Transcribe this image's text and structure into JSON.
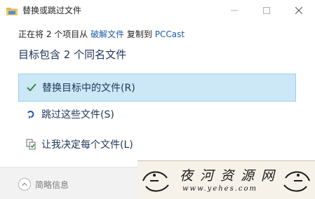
{
  "window": {
    "title": "替换或跳过文件",
    "minimize": "—",
    "maximize": "☐",
    "close": "✕"
  },
  "source_line": {
    "prefix": "正在将 2 个项目从 ",
    "source": "破解文件",
    "middle": " 复制到 ",
    "destination": "PCCast"
  },
  "headline": "目标包含 2 个同名文件",
  "options": {
    "replace": "替换目标中的文件(R)",
    "skip": "跳过这些文件(S)",
    "decide": "让我决定每个文件(L)"
  },
  "footer": {
    "details_label": "简略信息"
  },
  "watermark": {
    "title": "夜河资源网",
    "url": "www.yehes.com"
  },
  "colors": {
    "accent_link": "#1e5aa8",
    "selected_bg": "#cce8f6",
    "check_green": "#2e8b3d",
    "skip_blue": "#1e5aa8"
  }
}
